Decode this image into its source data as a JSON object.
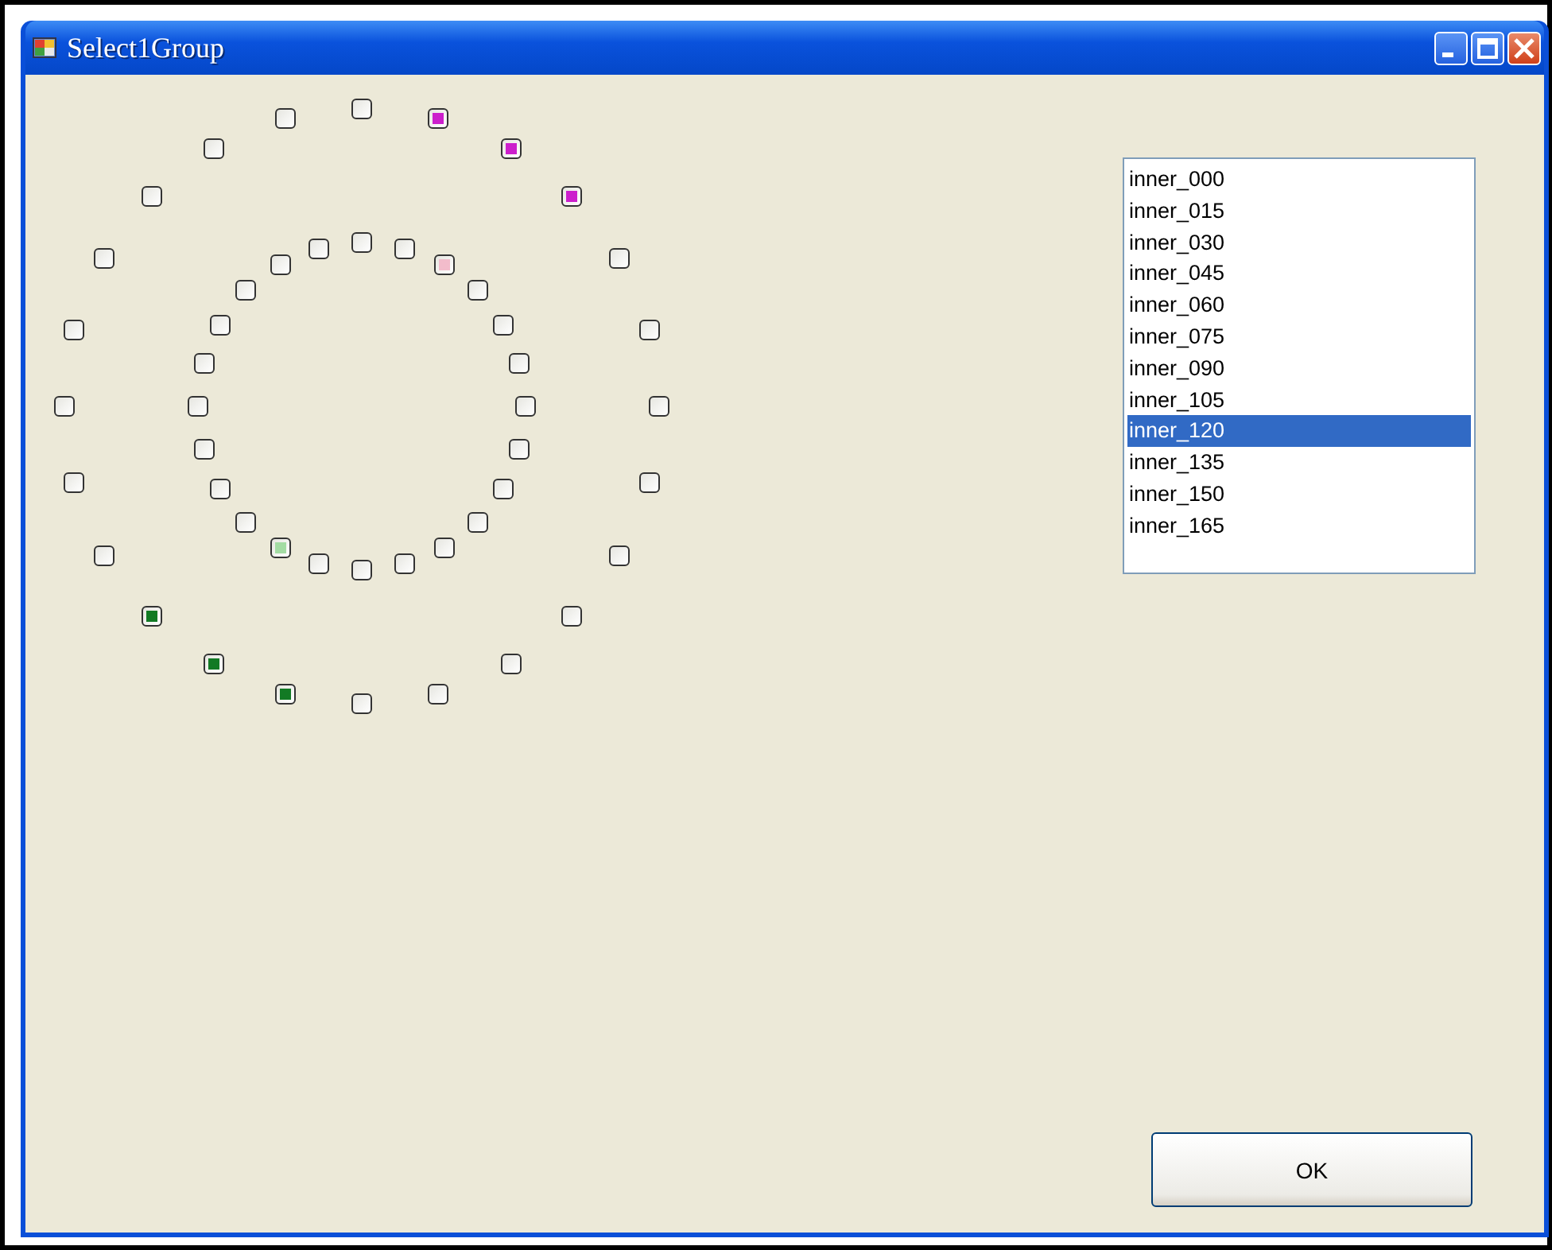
{
  "window": {
    "title": "Select1Group"
  },
  "rings": [
    {
      "kind": "outer",
      "checkboxes": [
        {
          "checked": false
        },
        {
          "checked": true,
          "color": "#cc1fcc"
        },
        {
          "checked": true,
          "color": "#cc1fcc"
        },
        {
          "checked": true,
          "color": "#cc1fcc"
        },
        {
          "checked": false
        },
        {
          "checked": false
        },
        {
          "checked": false
        },
        {
          "checked": false
        },
        {
          "checked": false
        },
        {
          "checked": false
        },
        {
          "checked": false
        },
        {
          "checked": false
        },
        {
          "checked": false
        },
        {
          "checked": true,
          "color": "#127a24"
        },
        {
          "checked": true,
          "color": "#127a24"
        },
        {
          "checked": true,
          "color": "#127a24"
        },
        {
          "checked": false
        },
        {
          "checked": false
        },
        {
          "checked": false
        },
        {
          "checked": false
        },
        {
          "checked": false
        },
        {
          "checked": false
        },
        {
          "checked": false
        },
        {
          "checked": false
        }
      ]
    },
    {
      "kind": "inner",
      "checkboxes": [
        {
          "checked": false
        },
        {
          "checked": false
        },
        {
          "checked": true,
          "color": "#f2bccb"
        },
        {
          "checked": false
        },
        {
          "checked": false
        },
        {
          "checked": false
        },
        {
          "checked": false
        },
        {
          "checked": false
        },
        {
          "checked": false
        },
        {
          "checked": false
        },
        {
          "checked": false
        },
        {
          "checked": false
        },
        {
          "checked": false
        },
        {
          "checked": false
        },
        {
          "checked": true,
          "color": "#a3dca3"
        },
        {
          "checked": false
        },
        {
          "checked": false
        },
        {
          "checked": false
        },
        {
          "checked": false
        },
        {
          "checked": false
        },
        {
          "checked": false
        },
        {
          "checked": false
        },
        {
          "checked": false
        },
        {
          "checked": false
        }
      ]
    }
  ],
  "listbox": {
    "items": [
      {
        "label": "inner_000",
        "selected": false
      },
      {
        "label": "inner_015",
        "selected": false
      },
      {
        "label": "inner_030",
        "selected": false
      },
      {
        "label": "inner_045",
        "selected": false
      },
      {
        "label": "inner_060",
        "selected": false
      },
      {
        "label": "inner_075",
        "selected": false
      },
      {
        "label": "inner_090",
        "selected": false
      },
      {
        "label": "inner_105",
        "selected": false
      },
      {
        "label": "inner_120",
        "selected": true
      },
      {
        "label": "inner_135",
        "selected": false
      },
      {
        "label": "inner_150",
        "selected": false
      },
      {
        "label": "inner_165",
        "selected": false
      }
    ]
  },
  "buttons": [
    {
      "label": "OK"
    }
  ]
}
